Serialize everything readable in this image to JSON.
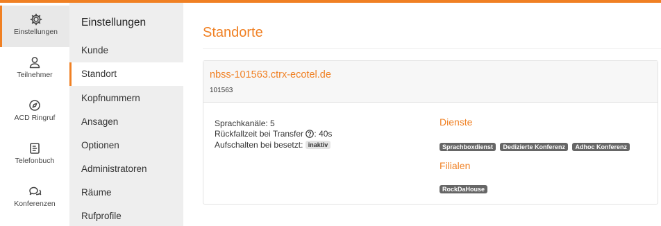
{
  "rail": {
    "items": [
      {
        "label": "Einstellungen",
        "icon": "gear-icon"
      },
      {
        "label": "Teilnehmer",
        "icon": "user-icon"
      },
      {
        "label": "ACD Ringruf",
        "icon": "compass-icon"
      },
      {
        "label": "Telefonbuch",
        "icon": "phonebook-icon"
      },
      {
        "label": "Konferenzen",
        "icon": "chat-icon"
      }
    ]
  },
  "submenu": {
    "title": "Einstellungen",
    "items": [
      "Kunde",
      "Standort",
      "Kopfnummern",
      "Ansagen",
      "Optionen",
      "Administratoren",
      "Räume",
      "Rufprofile"
    ]
  },
  "main": {
    "title": "Standorte",
    "card": {
      "host": "nbss-101563.ctrx-ecotel.de",
      "id": "101563",
      "channels": "Sprachkanäle: 5",
      "fallback_label": "Rückfallzeit bei Transfer",
      "fallback_value": ": 40s",
      "barge_label": "Aufschalten bei besetzt:",
      "barge_status": "inaktiv",
      "services_title": "Dienste",
      "services": [
        "Sprachboxdienst",
        "Dedizierte Konferenz",
        "Adhoc Konferenz"
      ],
      "branches_title": "Filialen",
      "branches": [
        "RockDaHouse"
      ]
    }
  },
  "colors": {
    "accent": "#f08023",
    "badge": "#666666"
  }
}
